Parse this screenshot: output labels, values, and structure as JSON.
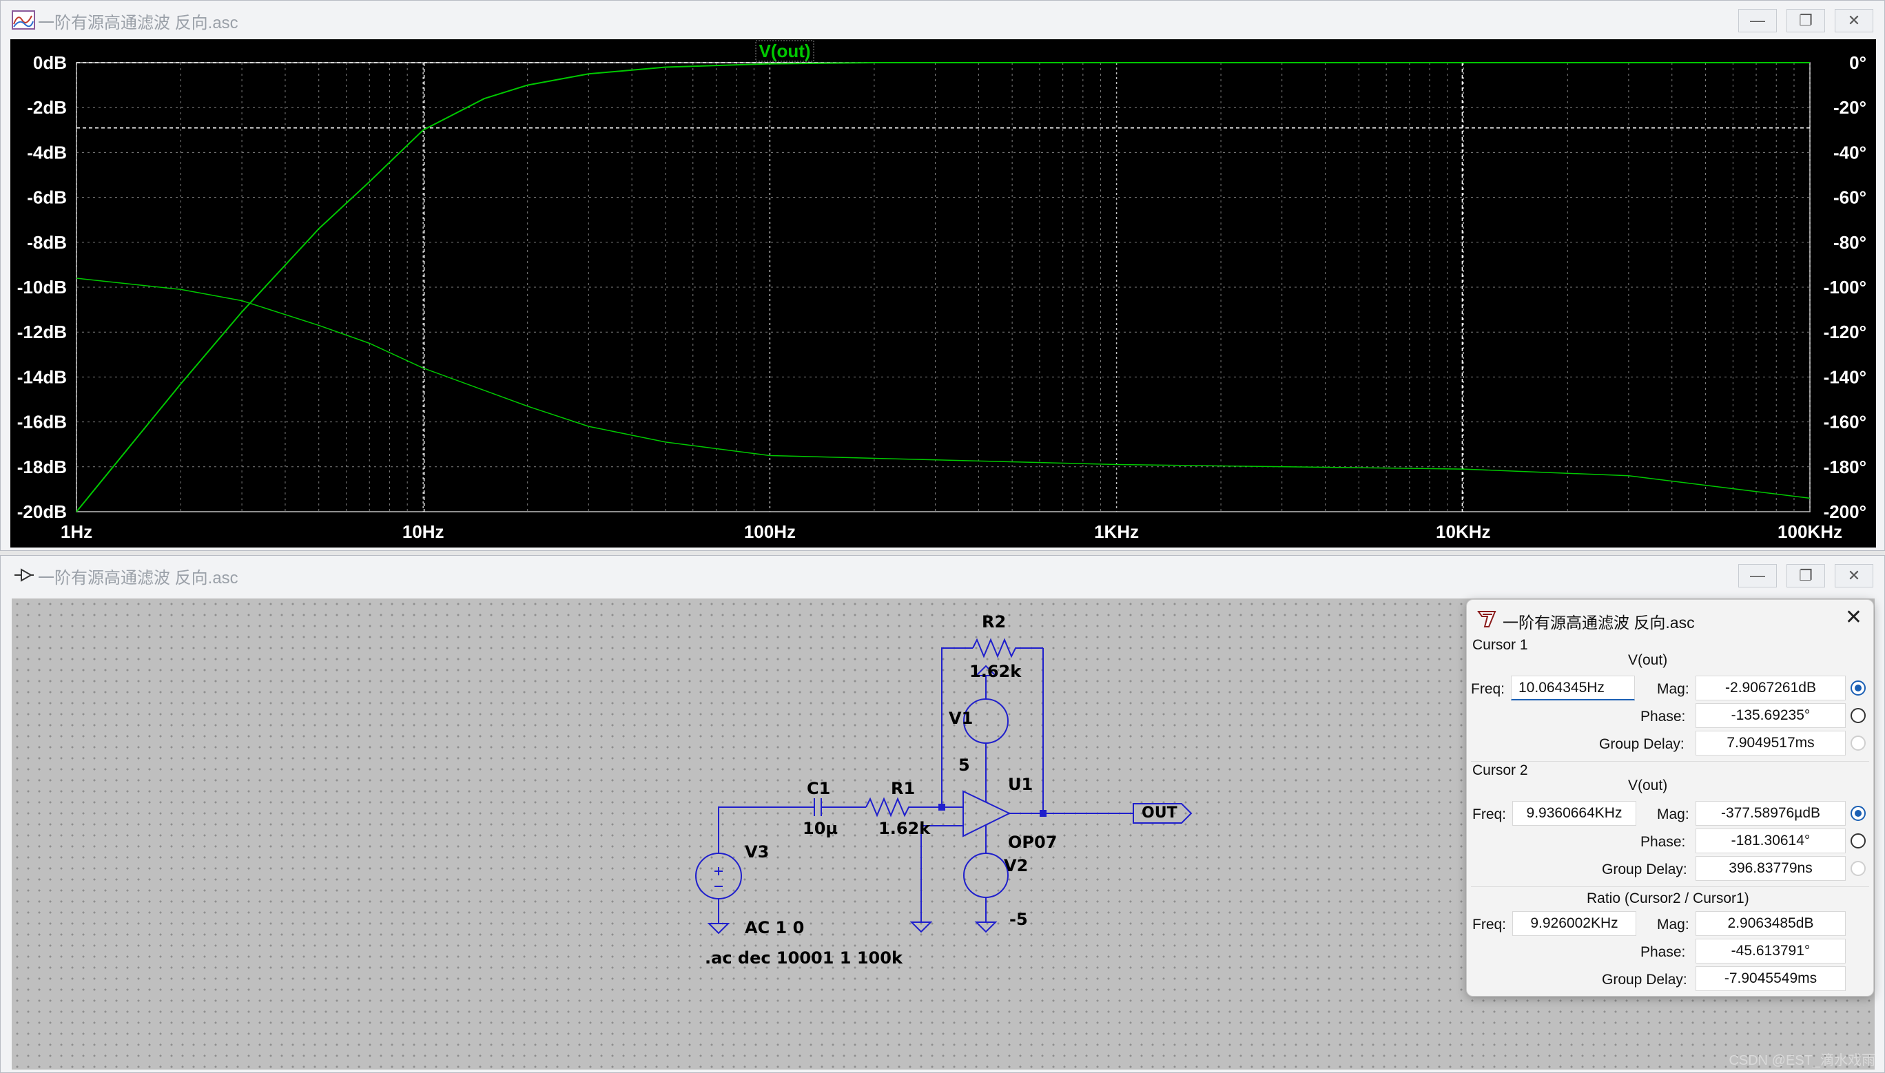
{
  "plot_window": {
    "title": "一阶有源高通滤波 反向.asc",
    "trace_label": "V(out)",
    "colors": {
      "trace": "#00c800",
      "grid": "#7f7f7f",
      "axis_text": "#ffffff",
      "background": "#000000"
    }
  },
  "chart_data": {
    "type": "line",
    "title": "V(out)",
    "x_scale": "log",
    "x_range_hz": [
      1,
      100000
    ],
    "x_ticks": [
      "1Hz",
      "10Hz",
      "100Hz",
      "1KHz",
      "10KHz",
      "100KHz"
    ],
    "y_left_ticks": [
      "0dB",
      "-2dB",
      "-4dB",
      "-6dB",
      "-8dB",
      "-10dB",
      "-12dB",
      "-14dB",
      "-16dB",
      "-18dB",
      "-20dB"
    ],
    "y_right_ticks": [
      "0°",
      "-20°",
      "-40°",
      "-60°",
      "-80°",
      "-100°",
      "-120°",
      "-140°",
      "-160°",
      "-180°",
      "-200°"
    ],
    "ylim_db": [
      -20,
      0
    ],
    "ylim_deg": [
      -200,
      0
    ],
    "grid": true,
    "series": [
      {
        "name": "magnitude",
        "axis": "left",
        "x": [
          1,
          2,
          3,
          5,
          7,
          10,
          15,
          20,
          30,
          50,
          100,
          200,
          1000,
          10000,
          100000
        ],
        "y": [
          -20.0,
          -14.3,
          -11.1,
          -7.4,
          -5.3,
          -3.0,
          -1.6,
          -1.0,
          -0.5,
          -0.2,
          -0.05,
          0,
          0,
          0,
          0
        ]
      },
      {
        "name": "phase",
        "axis": "right",
        "x": [
          1,
          2,
          3,
          5,
          7,
          10,
          20,
          30,
          50,
          100,
          1000,
          10000,
          30000,
          100000
        ],
        "y": [
          -96,
          -101,
          -106,
          -117,
          -125,
          -136,
          -153,
          -162,
          -169,
          -175,
          -179,
          -181,
          -184,
          -194
        ]
      }
    ],
    "cursor_markers": [
      {
        "x": 10.064345,
        "y_db": -2.9067261
      },
      {
        "x": 9936.0664,
        "y_db": -0.00037758976
      }
    ]
  },
  "schematic_window": {
    "title": "一阶有源高通滤波 反向.asc",
    "components": {
      "r2_name": "R2",
      "r2_value": "1.62k",
      "v1_name": "V1",
      "v1_value": "5",
      "u1_name": "U1",
      "u1_model": "OP07",
      "v2_name": "V2",
      "v2_value": "-5",
      "c1_name": "C1",
      "c1_value": "10µ",
      "r1_name": "R1",
      "r1_value": "1.62k",
      "v3_name": "V3",
      "v3_value": "AC 1 0",
      "out_label": "OUT",
      "directive": ".ac dec 10001 1 100k"
    },
    "colors": {
      "wire": "#1f1fcc",
      "background": "#bfbfbf",
      "grid_dot": "#8e8e8e"
    }
  },
  "cursor_dialog": {
    "title": "一阶有源高通滤波 反向.asc",
    "cursor1": {
      "header": "Cursor 1",
      "trace": "V(out)",
      "freq_label": "Freq:",
      "freq": "10.064345Hz",
      "mag_label": "Mag:",
      "mag": "-2.9067261dB",
      "phase_label": "Phase:",
      "phase": "-135.69235°",
      "gd_label": "Group Delay:",
      "gd": "7.9049517ms"
    },
    "cursor2": {
      "header": "Cursor 2",
      "trace": "V(out)",
      "freq_label": "Freq:",
      "freq": "9.9360664KHz",
      "mag_label": "Mag:",
      "mag": "-377.58976µdB",
      "phase_label": "Phase:",
      "phase": "-181.30614°",
      "gd_label": "Group Delay:",
      "gd": "396.83779ns"
    },
    "ratio": {
      "header": "Ratio (Cursor2 / Cursor1)",
      "freq_label": "Freq:",
      "freq": "9.926002KHz",
      "mag_label": "Mag:",
      "mag": "2.9063485dB",
      "phase_label": "Phase:",
      "phase": "-45.613791°",
      "gd_label": "Group Delay:",
      "gd": "-7.9045549ms"
    }
  },
  "watermark": "CSDN @EST_滴水戏雨"
}
